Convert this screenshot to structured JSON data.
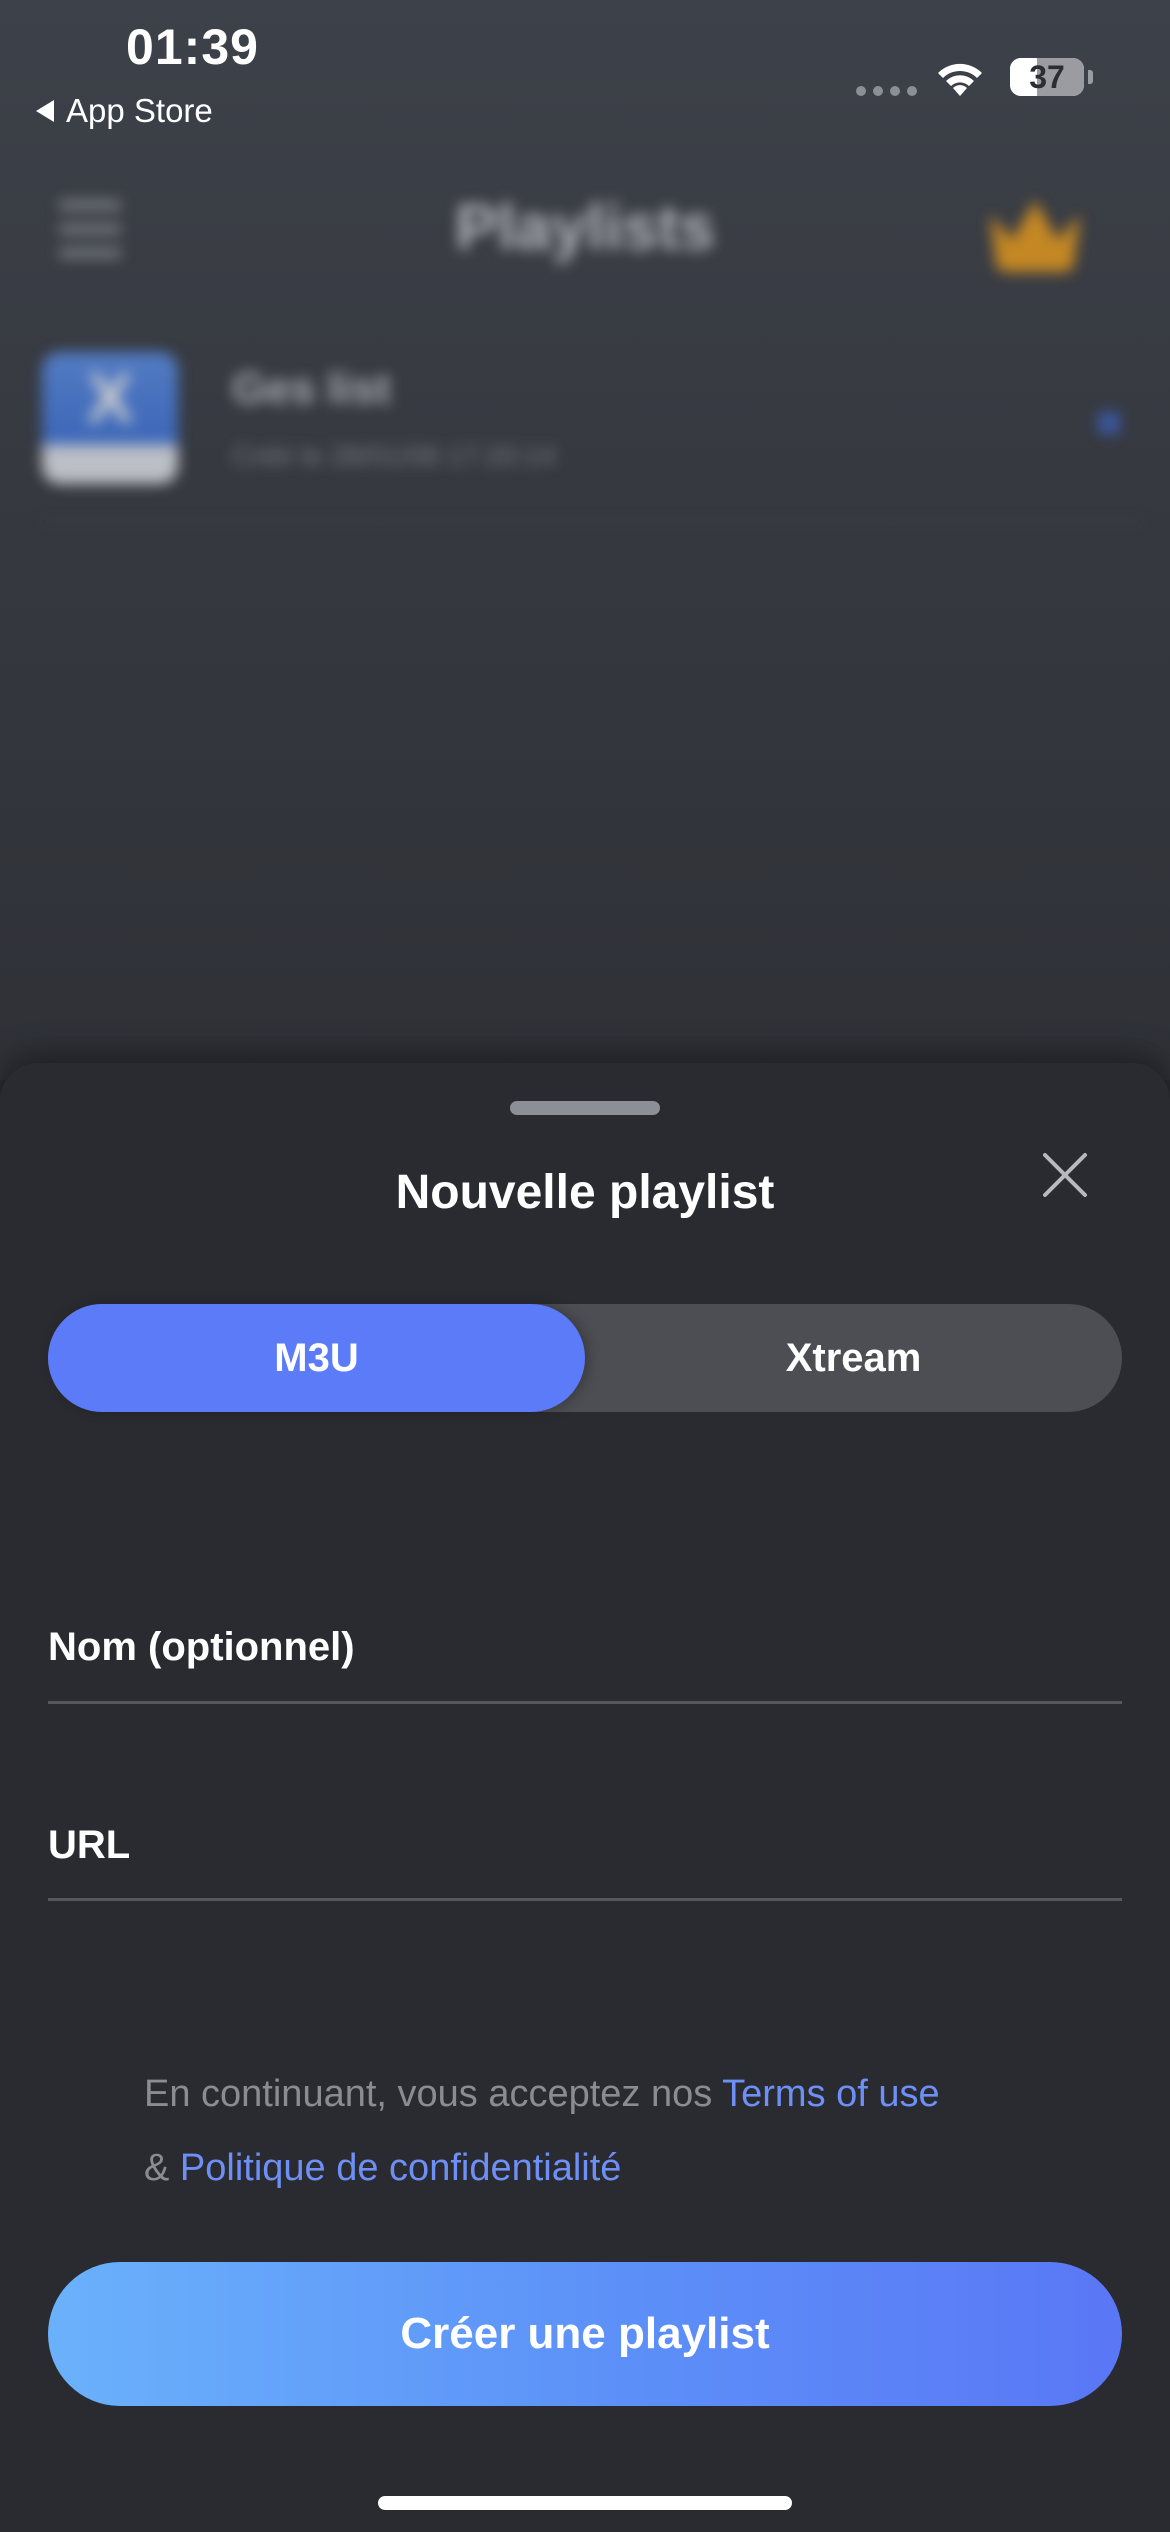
{
  "status_bar": {
    "time": "01:39",
    "back_label": "App Store",
    "battery_level": "37",
    "battery_fraction": 0.37
  },
  "background_app": {
    "title": "Playlists",
    "playlist_item": {
      "thumb_letter": "X",
      "name": "Ges list",
      "subtitle": "Créé le 28/01/08 17:20:14"
    }
  },
  "sheet": {
    "title": "Nouvelle playlist",
    "segments": [
      {
        "label": "M3U",
        "active": true
      },
      {
        "label": "Xtream",
        "active": false
      }
    ],
    "fields": {
      "name": {
        "label": "Nom (optionnel)",
        "value": ""
      },
      "url": {
        "label": "URL",
        "value": ""
      }
    },
    "legal": {
      "prefix": "En continuant, vous acceptez nos ",
      "terms_link": "Terms of use",
      "joiner": "& ",
      "privacy_link": "Politique de confidentialité"
    },
    "create_button": "Créer une playlist"
  },
  "colors": {
    "accent": "#5b7bf8",
    "link": "#6e8ff5",
    "sheet_bg": "#2a2b30",
    "segment_bg": "#4d4e53",
    "crown": "#f3a11a"
  },
  "icons": {
    "close": "close-icon",
    "wifi": "wifi-icon",
    "back": "back-arrow-icon",
    "menu": "hamburger-menu-icon",
    "crown": "crown-icon"
  }
}
